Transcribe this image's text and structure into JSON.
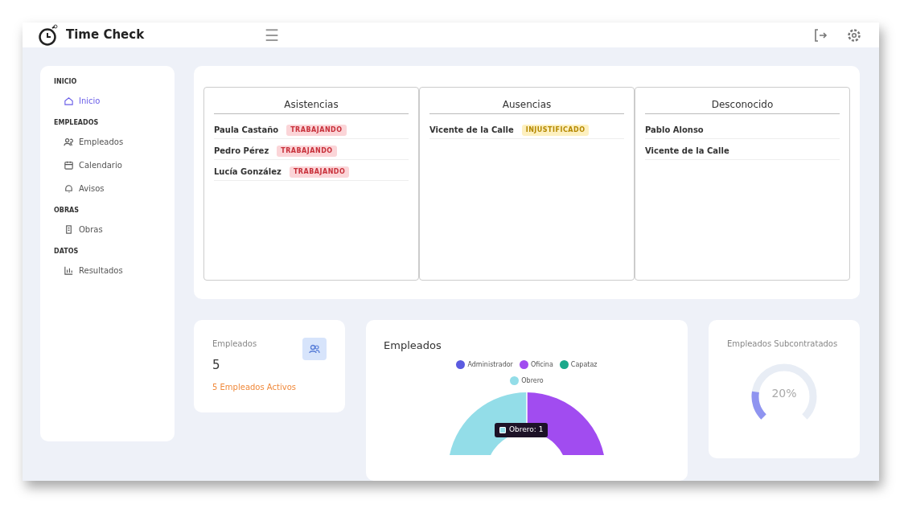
{
  "header": {
    "title": "Time Check",
    "menu_icon": "☰"
  },
  "sidebar": {
    "sections": [
      {
        "heading": "INICIO",
        "items": [
          {
            "label": "Inicio",
            "kind": "home",
            "selected": true
          }
        ]
      },
      {
        "heading": "EMPLEADOS",
        "items": [
          {
            "label": "Empleados",
            "kind": "users",
            "selected": false
          },
          {
            "label": "Calendario",
            "kind": "calendar",
            "selected": false
          },
          {
            "label": "Avisos",
            "kind": "bell",
            "selected": false
          }
        ]
      },
      {
        "heading": "OBRAS",
        "items": [
          {
            "label": "Obras",
            "kind": "building",
            "selected": false
          }
        ]
      },
      {
        "heading": "DATOS",
        "items": [
          {
            "label": "Resultados",
            "kind": "chart",
            "selected": false
          }
        ]
      }
    ]
  },
  "panels": [
    {
      "title": "Asistencias",
      "rows": [
        {
          "name": "Paula Castaño",
          "status": "TRABAJANDO",
          "kind": "working"
        },
        {
          "name": "Pedro Pérez",
          "status": "TRABAJANDO",
          "kind": "working"
        },
        {
          "name": "Lucía González",
          "status": "TRABAJANDO",
          "kind": "working"
        }
      ]
    },
    {
      "title": "Ausencias",
      "rows": [
        {
          "name": "Vicente de la Calle",
          "status": "INJUSTIFICADO",
          "kind": "unjustified"
        }
      ]
    },
    {
      "title": "Desconocido",
      "rows": [
        {
          "name": "Pablo Alonso"
        },
        {
          "name": "Vicente de la Calle"
        }
      ]
    }
  ],
  "stat_card": {
    "label": "Empleados",
    "value": "5",
    "note": "5 Empleados Activos"
  },
  "chart_card": {
    "title": "Empleados",
    "legend": [
      {
        "label": "Administrador",
        "color": "#5b5be0"
      },
      {
        "label": "Oficina",
        "color": "#a14cf0"
      },
      {
        "label": "Capataz",
        "color": "#1aa88a"
      },
      {
        "label": "Obrero",
        "color": "#93dde8"
      }
    ],
    "tooltip": "Obrero: 1"
  },
  "gauge_card": {
    "label": "Empleados Subcontratados",
    "level": 0.2,
    "reading": "20%"
  }
}
